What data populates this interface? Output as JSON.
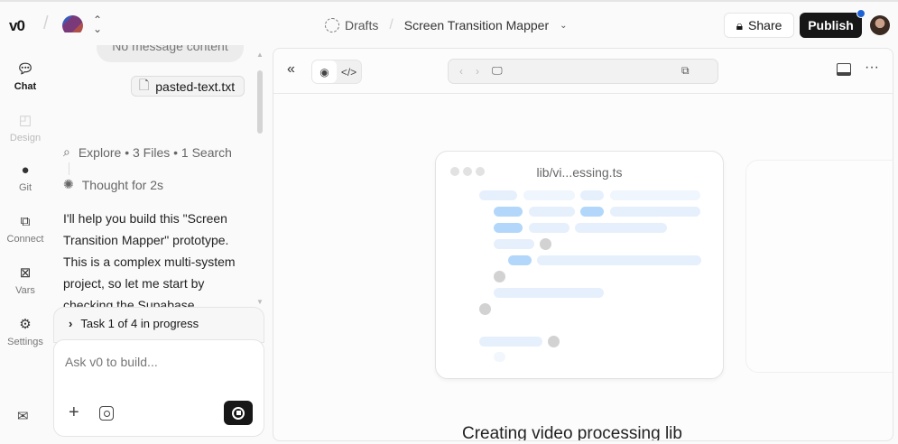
{
  "header": {
    "logo": "v0",
    "project_switcher_icon": "chevron-up-down-icon",
    "breadcrumb": {
      "drafts": "Drafts",
      "separator": "/",
      "project": "Screen Transition Mapper"
    },
    "share_label": "Share",
    "publish_label": "Publish",
    "notification_color": "#1d63d6"
  },
  "rail": {
    "items": [
      {
        "label": "Chat",
        "icon": "chat-bubble-icon",
        "active": true
      },
      {
        "label": "Design",
        "icon": "design-icon"
      },
      {
        "label": "Git",
        "icon": "github-icon"
      },
      {
        "label": "Connect",
        "icon": "plug-icon"
      },
      {
        "label": "Vars",
        "icon": "variable-icon"
      },
      {
        "label": "Settings",
        "icon": "gear-icon"
      }
    ],
    "mail_icon": "mail-icon"
  },
  "chat": {
    "bubble": "No message content",
    "attachment": "pasted-text.txt",
    "explore": "Explore • 3 Files • 1 Search",
    "thought": "Thought for 2s",
    "message": "I'll help you build this \"Screen Transition Mapper\" prototype. This is a complex multi-system project, so let me start by checking the Supabase",
    "task": "Task 1 of 4 in progress",
    "input_placeholder": "Ask v0 to build..."
  },
  "preview": {
    "file_name": "lib/vi...essing.ts",
    "status": "Creating video processing lib"
  }
}
